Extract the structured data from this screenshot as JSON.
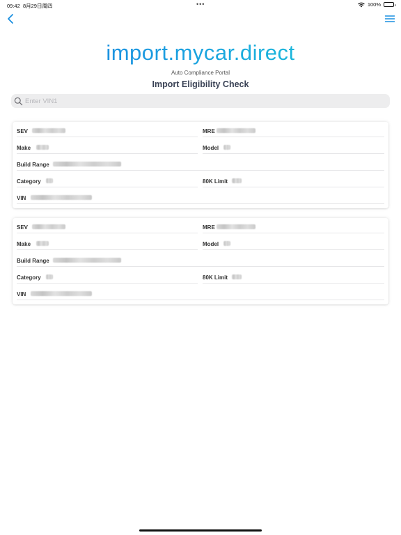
{
  "status_bar": {
    "time": "09:42",
    "date": "8月29日周四",
    "dots": "•••",
    "battery": "100%"
  },
  "nav": {
    "back_icon": "chevron-left-icon",
    "menu_icon": "hamburger-menu-icon"
  },
  "header": {
    "brand": "import.mycar.direct",
    "subtitle": "Auto Compliance Portal",
    "title": "Import Eligibility Check"
  },
  "search": {
    "placeholder": "Enter VIN1",
    "value": ""
  },
  "results": [
    {
      "sev_label": "SEV",
      "mre_label": "MRE",
      "make_label": "Make",
      "model_label": "Model",
      "build_range_label": "Build Range",
      "category_label": "Category",
      "limit_label": "80K Limit",
      "vin_label": "VIN"
    },
    {
      "sev_label": "SEV",
      "mre_label": "MRE",
      "make_label": "Make",
      "model_label": "Model",
      "build_range_label": "Build Range",
      "category_label": "Category",
      "limit_label": "80K Limit",
      "vin_label": "VIN"
    }
  ],
  "colors": {
    "accent": "#1a8fe0",
    "brand_gradient_start": "#1e7fe0",
    "brand_gradient_end": "#1ac9d6",
    "title": "#3a4255"
  }
}
